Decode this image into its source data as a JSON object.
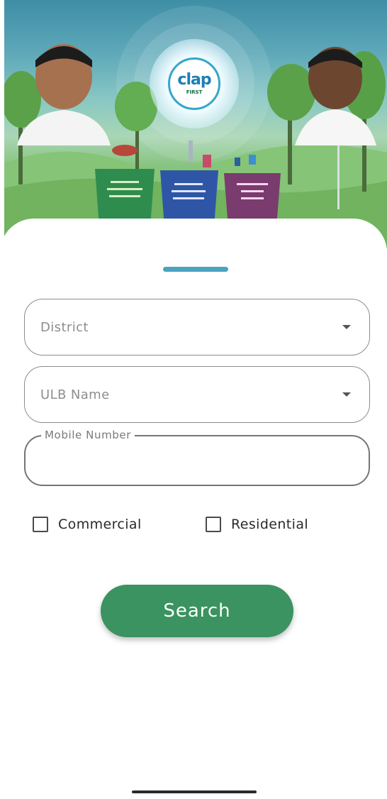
{
  "banner": {
    "logo_text": "clap",
    "logo_subtext": "FIRST",
    "bins": [
      {
        "color": "#2f8c4f",
        "name": "green-bin"
      },
      {
        "color": "#2f56a6",
        "name": "blue-bin"
      },
      {
        "color": "#7a3b6e",
        "name": "purple-bin"
      }
    ]
  },
  "form": {
    "district_placeholder": "District",
    "ulb_placeholder": "ULB Name",
    "mobile_label": "Mobile Number",
    "mobile_value": "",
    "options": [
      {
        "label": "Commercial",
        "checked": false
      },
      {
        "label": "Residential",
        "checked": false
      }
    ],
    "search_label": "Search"
  },
  "colors": {
    "accent_handle": "#4aa3bf",
    "button": "#3a9360"
  }
}
